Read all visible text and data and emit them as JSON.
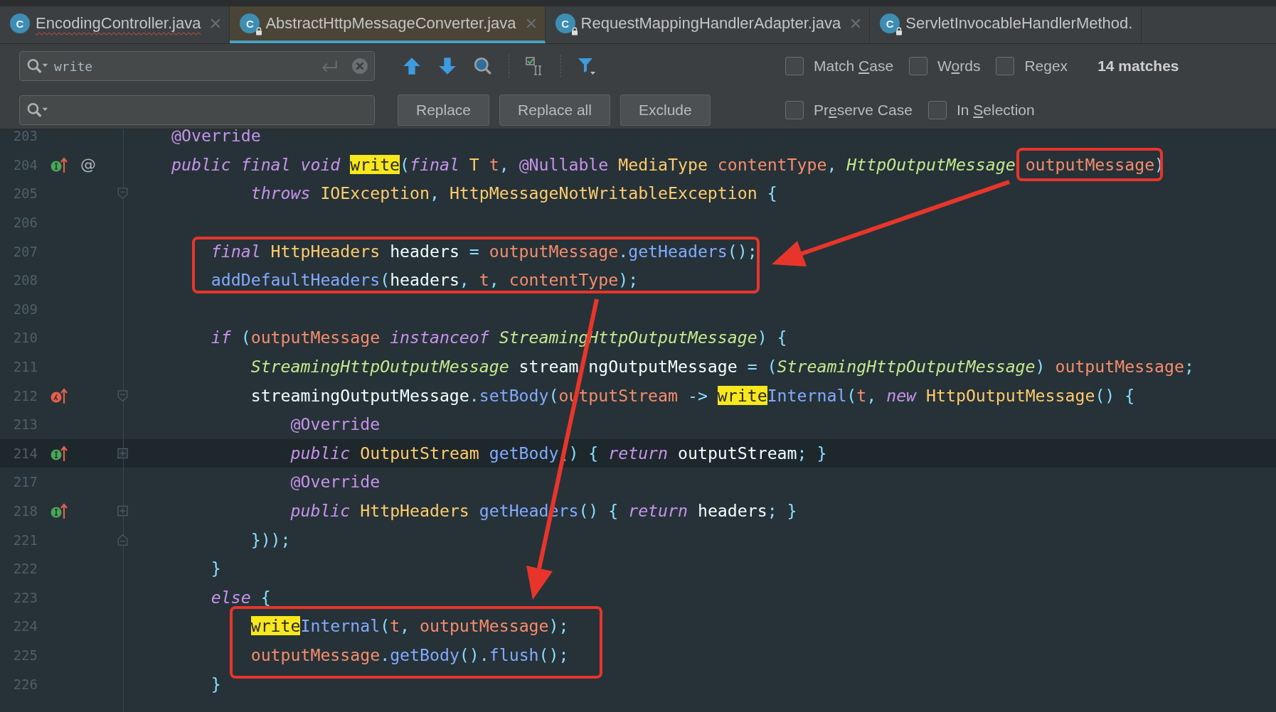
{
  "tabs": [
    {
      "label": "EncodingController.java",
      "icon_letter": "C",
      "locked": false,
      "error": true,
      "closable": true,
      "selected": false
    },
    {
      "label": "AbstractHttpMessageConverter.java",
      "icon_letter": "C",
      "locked": true,
      "error": false,
      "closable": true,
      "selected": true
    },
    {
      "label": "RequestMappingHandlerAdapter.java",
      "icon_letter": "C",
      "locked": true,
      "error": false,
      "closable": true,
      "selected": false
    },
    {
      "label": "ServletInvocableHandlerMethod.",
      "icon_letter": "C",
      "locked": true,
      "error": false,
      "closable": false,
      "selected": false
    }
  ],
  "find": {
    "query": "write",
    "options_row_1": [
      {
        "before": "Match ",
        "key": "C",
        "after": "ase",
        "checked": false
      },
      {
        "before": "W",
        "key": "o",
        "after": "rds",
        "checked": false
      },
      {
        "before": "Re",
        "key": "g",
        "after": "ex",
        "checked": false
      }
    ],
    "match_count": "14 matches",
    "buttons": [
      "Replace",
      "Replace all",
      "Exclude"
    ],
    "options_row_2": [
      {
        "before": "Pr",
        "key": "e",
        "after": "serve Case",
        "checked": false
      },
      {
        "before": "In ",
        "key": "S",
        "after": "election",
        "checked": false
      }
    ]
  },
  "editor": {
    "lines": [
      {
        "number": "203",
        "current": false,
        "tokens": [
          {
            "text": "@Override",
            "kind": "a"
          }
        ]
      },
      {
        "number": "204",
        "current": false,
        "marker": {
          "kind": "override"
        },
        "at_sign": "@",
        "tokens": [
          {
            "text": "public final void ",
            "kind": "k"
          },
          {
            "text": "write",
            "kind": "m"
          },
          {
            "text": "(",
            "kind": "s"
          },
          {
            "text": "final ",
            "kind": "k"
          },
          {
            "text": "T ",
            "kind": "t"
          },
          {
            "text": "t",
            "kind": "p"
          },
          {
            "text": ", ",
            "kind": "s"
          },
          {
            "text": "@Nullable ",
            "kind": "a"
          },
          {
            "text": "MediaType ",
            "kind": "t"
          },
          {
            "text": "contentType",
            "kind": "p"
          },
          {
            "text": ", ",
            "kind": "s"
          },
          {
            "text": "HttpOutputMessage ",
            "kind": "ti"
          },
          {
            "text": "outputMessage",
            "kind": "p"
          },
          {
            "text": ")",
            "kind": "s"
          }
        ]
      },
      {
        "number": "205",
        "current": false,
        "fold": {
          "kind": "start"
        },
        "indent": {
          "kind": "nested"
        },
        "tokens": [
          {
            "text": "throws ",
            "kind": "k"
          },
          {
            "text": "IOException",
            "kind": "t"
          },
          {
            "text": ", ",
            "kind": "s"
          },
          {
            "text": "HttpMessageNotWritableException ",
            "kind": "t"
          },
          {
            "text": "{",
            "kind": "s"
          }
        ]
      },
      {
        "number": "206",
        "current": false
      },
      {
        "number": "207",
        "current": false,
        "indent": {
          "kind": "body"
        },
        "tokens": [
          {
            "text": "final ",
            "kind": "k"
          },
          {
            "text": "HttpHeaders ",
            "kind": "t"
          },
          {
            "text": "headers ",
            "kind": "x"
          },
          {
            "text": "= ",
            "kind": "s"
          },
          {
            "text": "outputMessage",
            "kind": "p"
          },
          {
            "text": ".",
            "kind": "s"
          },
          {
            "text": "getHeaders",
            "kind": "f"
          },
          {
            "text": "();",
            "kind": "s"
          }
        ]
      },
      {
        "number": "208",
        "current": false,
        "indent": {
          "kind": "body"
        },
        "tokens": [
          {
            "text": "addDefaultHeaders",
            "kind": "f"
          },
          {
            "text": "(",
            "kind": "s"
          },
          {
            "text": "headers",
            "kind": "x"
          },
          {
            "text": ", ",
            "kind": "s"
          },
          {
            "text": "t",
            "kind": "p"
          },
          {
            "text": ", ",
            "kind": "s"
          },
          {
            "text": "contentType",
            "kind": "p"
          },
          {
            "text": ");",
            "kind": "s"
          }
        ]
      },
      {
        "number": "209",
        "current": false
      },
      {
        "number": "210",
        "current": false,
        "indent": {
          "kind": "body"
        },
        "tokens": [
          {
            "text": "if ",
            "kind": "k"
          },
          {
            "text": "(",
            "kind": "s"
          },
          {
            "text": "outputMessage ",
            "kind": "p"
          },
          {
            "text": "instanceof ",
            "kind": "k"
          },
          {
            "text": "StreamingHttpOutputMessage",
            "kind": "ti"
          },
          {
            "text": ") {",
            "kind": "s"
          }
        ]
      },
      {
        "number": "211",
        "current": false,
        "indent": {
          "kind": "nested"
        },
        "tokens": [
          {
            "text": "StreamingHttpOutputMessage ",
            "kind": "ti"
          },
          {
            "text": "stream",
            "kind": "x"
          },
          {
            "kind": "covered"
          },
          {
            "text": "ngOutputMessage ",
            "kind": "x"
          },
          {
            "text": "= (",
            "kind": "s"
          },
          {
            "text": "StreamingHttpOutputMessage",
            "kind": "ti"
          },
          {
            "text": ") ",
            "kind": "s"
          },
          {
            "text": "outputMessage",
            "kind": "p"
          },
          {
            "text": ";",
            "kind": "s"
          }
        ]
      },
      {
        "number": "212",
        "current": false,
        "marker": {
          "kind": "lambda"
        },
        "fold": {
          "kind": "start"
        },
        "indent": {
          "kind": "nested"
        },
        "tokens": [
          {
            "text": "streamingOutputMessage",
            "kind": "x"
          },
          {
            "text": ".",
            "kind": "s"
          },
          {
            "text": "setBody",
            "kind": "f"
          },
          {
            "text": "(",
            "kind": "s"
          },
          {
            "text": "outputStream ",
            "kind": "p"
          },
          {
            "text": "-> ",
            "kind": "s"
          },
          {
            "text": "write",
            "kind": "m"
          },
          {
            "text": "Internal",
            "kind": "f"
          },
          {
            "text": "(",
            "kind": "s"
          },
          {
            "text": "t",
            "kind": "p"
          },
          {
            "text": ", ",
            "kind": "s"
          },
          {
            "text": "new ",
            "kind": "k"
          },
          {
            "text": "HttpOutputMessage",
            "kind": "t"
          },
          {
            "text": "() {",
            "kind": "s"
          }
        ]
      },
      {
        "number": "213",
        "current": false,
        "indent": {
          "kind": "inner"
        },
        "tokens": [
          {
            "text": "@Override",
            "kind": "a"
          }
        ]
      },
      {
        "number": "214",
        "current": true,
        "marker": {
          "kind": "override"
        },
        "fold": {
          "kind": "collapsed"
        },
        "indent": {
          "kind": "inner"
        },
        "tokens": [
          {
            "text": "public ",
            "kind": "k"
          },
          {
            "text": "OutputStream ",
            "kind": "t"
          },
          {
            "text": "getBody",
            "kind": "f"
          },
          {
            "text": "() { ",
            "kind": "s"
          },
          {
            "text": "return ",
            "kind": "k"
          },
          {
            "text": "outputStream",
            "kind": "x"
          },
          {
            "text": "; }",
            "kind": "s"
          }
        ]
      },
      {
        "number": "217",
        "current": false,
        "indent": {
          "kind": "inner"
        },
        "tokens": [
          {
            "text": "@Override",
            "kind": "a"
          }
        ]
      },
      {
        "number": "218",
        "current": false,
        "marker": {
          "kind": "override"
        },
        "fold": {
          "kind": "collapsed"
        },
        "indent": {
          "kind": "inner"
        },
        "tokens": [
          {
            "text": "public ",
            "kind": "k"
          },
          {
            "text": "HttpHeaders ",
            "kind": "t"
          },
          {
            "text": "getHeaders",
            "kind": "f"
          },
          {
            "text": "() { ",
            "kind": "s"
          },
          {
            "text": "return ",
            "kind": "k"
          },
          {
            "text": "headers",
            "kind": "x"
          },
          {
            "text": "; }",
            "kind": "s"
          }
        ]
      },
      {
        "number": "221",
        "current": false,
        "fold": {
          "kind": "end"
        },
        "indent": {
          "kind": "nested"
        },
        "tokens": [
          {
            "text": "}));",
            "kind": "s"
          }
        ]
      },
      {
        "number": "222",
        "current": false,
        "indent": {
          "kind": "body"
        },
        "tokens": [
          {
            "text": "}",
            "kind": "s"
          }
        ]
      },
      {
        "number": "223",
        "current": false,
        "indent": {
          "kind": "body"
        },
        "tokens": [
          {
            "text": "else ",
            "kind": "k"
          },
          {
            "text": "{",
            "kind": "s"
          }
        ]
      },
      {
        "number": "224",
        "current": false,
        "indent": {
          "kind": "nested"
        },
        "tokens": [
          {
            "text": "write",
            "kind": "m"
          },
          {
            "text": "Internal",
            "kind": "f"
          },
          {
            "text": "(",
            "kind": "s"
          },
          {
            "text": "t",
            "kind": "p"
          },
          {
            "text": ", ",
            "kind": "s"
          },
          {
            "text": "outputMessage",
            "kind": "p"
          },
          {
            "text": ");",
            "kind": "s"
          }
        ]
      },
      {
        "number": "225",
        "current": false,
        "indent": {
          "kind": "nested"
        },
        "tokens": [
          {
            "text": "outputMessage",
            "kind": "p"
          },
          {
            "text": ".",
            "kind": "s"
          },
          {
            "text": "getBody",
            "kind": "f"
          },
          {
            "text": "().",
            "kind": "s"
          },
          {
            "text": "flush",
            "kind": "f"
          },
          {
            "text": "();",
            "kind": "s"
          }
        ]
      },
      {
        "number": "226",
        "current": false,
        "indent": {
          "kind": "body"
        },
        "tokens": [
          {
            "text": "}",
            "kind": "s"
          }
        ]
      }
    ]
  }
}
